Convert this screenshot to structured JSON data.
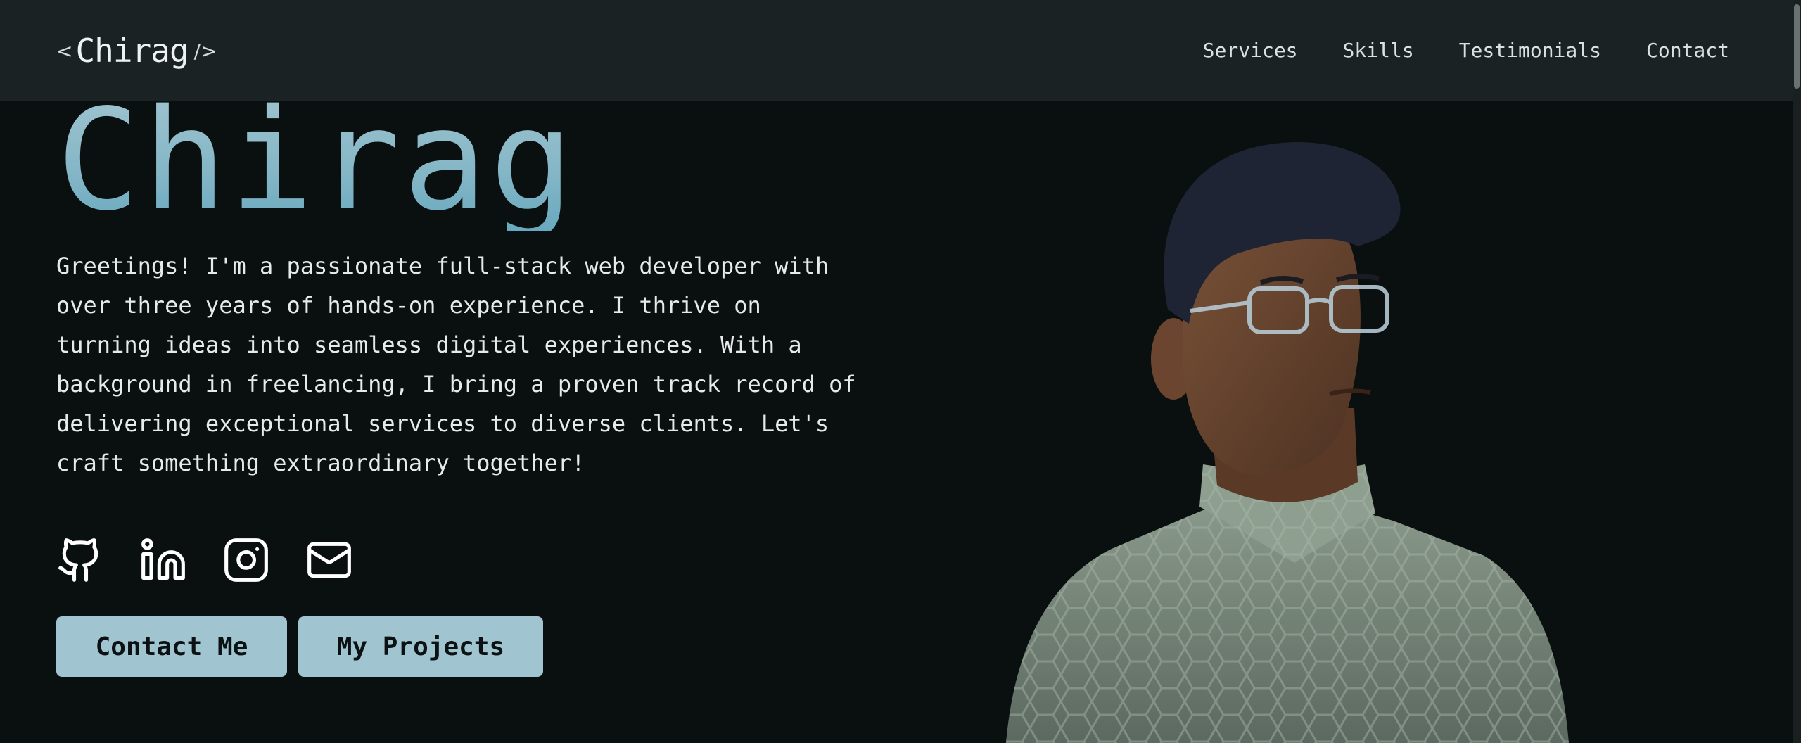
{
  "header": {
    "logo": {
      "open": "<",
      "name": "Chirag",
      "close": "/>"
    },
    "nav": [
      "Services",
      "Skills",
      "Testimonials",
      "Contact"
    ]
  },
  "hero": {
    "title": "Chirag",
    "description": "Greetings! I'm a passionate full-stack web developer with over three years of hands-on experience. I thrive on turning ideas into seamless digital experiences. With a background in freelancing, I bring a proven track record of delivering exceptional services to diverse clients. Let's craft something extraordinary together!",
    "socials": [
      "github-icon",
      "linkedin-icon",
      "instagram-icon",
      "mail-icon"
    ],
    "buttons": {
      "contact": "Contact Me",
      "projects": "My Projects"
    }
  },
  "colors": {
    "background": "#0a0f0f",
    "navbar": "#1b2224",
    "accent": "#a1c5d0",
    "title_gradient": [
      "#9fc3cf",
      "#69a9bf"
    ]
  }
}
